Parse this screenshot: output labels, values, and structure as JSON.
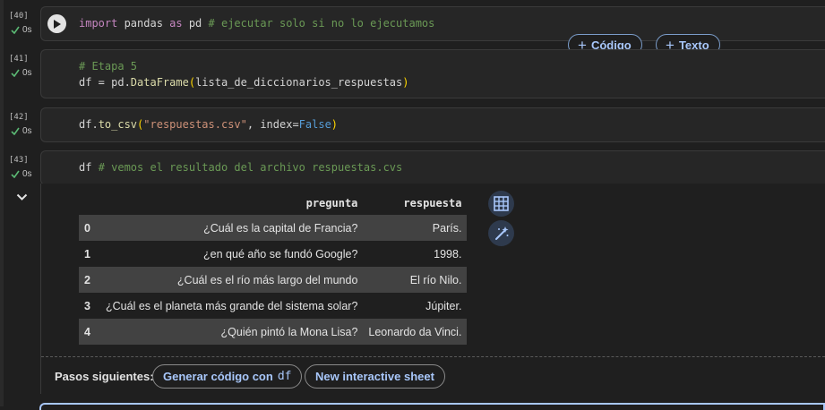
{
  "cells": [
    {
      "exec": "[40]",
      "time": "0s",
      "code": {
        "kw": "import",
        "t1": " pandas ",
        "kw2": "as",
        "t2": " pd ",
        "comment": "# ejecutar solo si no lo ejecutamos"
      }
    },
    {
      "exec": "[41]",
      "time": "0s",
      "code": {
        "comment": "# Etapa 5",
        "t1": "df = pd.",
        "fn": "DataFrame",
        "p1": "(",
        "arg": "lista_de_diccionarios_respuestas",
        "p2": ")"
      }
    },
    {
      "exec": "[42]",
      "time": "0s",
      "code": {
        "t1": "df.",
        "fn": "to_csv",
        "p1": "(",
        "str": "\"respuestas.csv\"",
        "t2": ", index=",
        "const": "False",
        "p2": ")"
      }
    },
    {
      "exec": "[43]",
      "time": "0s",
      "code": {
        "t1": "df ",
        "comment": "# vemos el resultado del archivo respuestas.cvs"
      }
    }
  ],
  "add_code_label": "Código",
  "add_text_label": "Texto",
  "table": {
    "columns": [
      "pregunta",
      "respuesta"
    ],
    "rows": [
      {
        "idx": "0",
        "pregunta": "¿Cuál es la capital de Francia?",
        "respuesta": "París."
      },
      {
        "idx": "1",
        "pregunta": "¿en qué año se fundó Google?",
        "respuesta": "1998."
      },
      {
        "idx": "2",
        "pregunta": "¿Cuál es el río más largo del mundo",
        "respuesta": "El río Nilo."
      },
      {
        "idx": "3",
        "pregunta": "¿Cuál es el planeta más grande del sistema solar?",
        "respuesta": "Júpiter."
      },
      {
        "idx": "4",
        "pregunta": "¿Quién pintó la Mona Lisa?",
        "respuesta": "Leonardo da Vinci."
      }
    ]
  },
  "next_steps": {
    "label": "Pasos siguientes:",
    "generate_label": "Generar código con",
    "generate_var": "df",
    "interactive_label": "New interactive sheet"
  },
  "icons": [
    "run-icon",
    "check-icon",
    "chevron-down-icon",
    "table-icon",
    "magic-wand-icon"
  ],
  "colors": {
    "accent": "#a8c7fa",
    "check": "#5bb974",
    "background": "#1f1f1f"
  }
}
